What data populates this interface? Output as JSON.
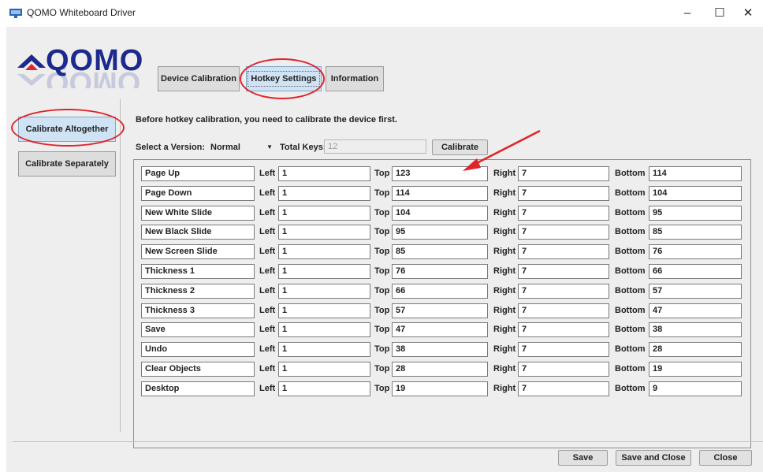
{
  "window": {
    "title": "QOMO Whiteboard Driver",
    "minimize_glyph": "–",
    "maximize_glyph": "☐",
    "close_glyph": "✕"
  },
  "brand": {
    "logo_text": "QOMO",
    "accent": "#1b2a8c"
  },
  "tabs": [
    {
      "label": "Device Calibration",
      "active": false
    },
    {
      "label": "Hotkey Settings",
      "active": true
    },
    {
      "label": "Information",
      "active": false
    }
  ],
  "sidebar": {
    "items": [
      {
        "label": "Calibrate Altogether",
        "active": true
      },
      {
        "label": "Calibrate Separately",
        "active": false
      }
    ]
  },
  "main": {
    "instruction": "Before hotkey calibration, you need to calibrate the device first.",
    "version_label": "Select a Version:",
    "version_value": "Normal",
    "total_keys_label": "Total Keys:",
    "total_keys_value": "12",
    "calibrate_label": "Calibrate",
    "col_labels": {
      "left": "Left",
      "top": "Top",
      "right": "Right",
      "bottom": "Bottom"
    },
    "hotkeys": [
      {
        "name": "Page Up",
        "left": "1",
        "top": "123",
        "right": "7",
        "bottom": "114"
      },
      {
        "name": "Page Down",
        "left": "1",
        "top": "114",
        "right": "7",
        "bottom": "104"
      },
      {
        "name": "New White Slide",
        "left": "1",
        "top": "104",
        "right": "7",
        "bottom": "95"
      },
      {
        "name": "New Black Slide",
        "left": "1",
        "top": "95",
        "right": "7",
        "bottom": "85"
      },
      {
        "name": "New Screen Slide",
        "left": "1",
        "top": "85",
        "right": "7",
        "bottom": "76"
      },
      {
        "name": "Thickness 1",
        "left": "1",
        "top": "76",
        "right": "7",
        "bottom": "66"
      },
      {
        "name": "Thickness 2",
        "left": "1",
        "top": "66",
        "right": "7",
        "bottom": "57"
      },
      {
        "name": "Thickness 3",
        "left": "1",
        "top": "57",
        "right": "7",
        "bottom": "47"
      },
      {
        "name": "Save",
        "left": "1",
        "top": "47",
        "right": "7",
        "bottom": "38"
      },
      {
        "name": "Undo",
        "left": "1",
        "top": "38",
        "right": "7",
        "bottom": "28"
      },
      {
        "name": "Clear Objects",
        "left": "1",
        "top": "28",
        "right": "7",
        "bottom": "19"
      },
      {
        "name": "Desktop",
        "left": "1",
        "top": "19",
        "right": "7",
        "bottom": "9"
      }
    ]
  },
  "footer": {
    "save": "Save",
    "save_close": "Save and Close",
    "close": "Close"
  },
  "annotations": {
    "color": "#e0242c"
  }
}
